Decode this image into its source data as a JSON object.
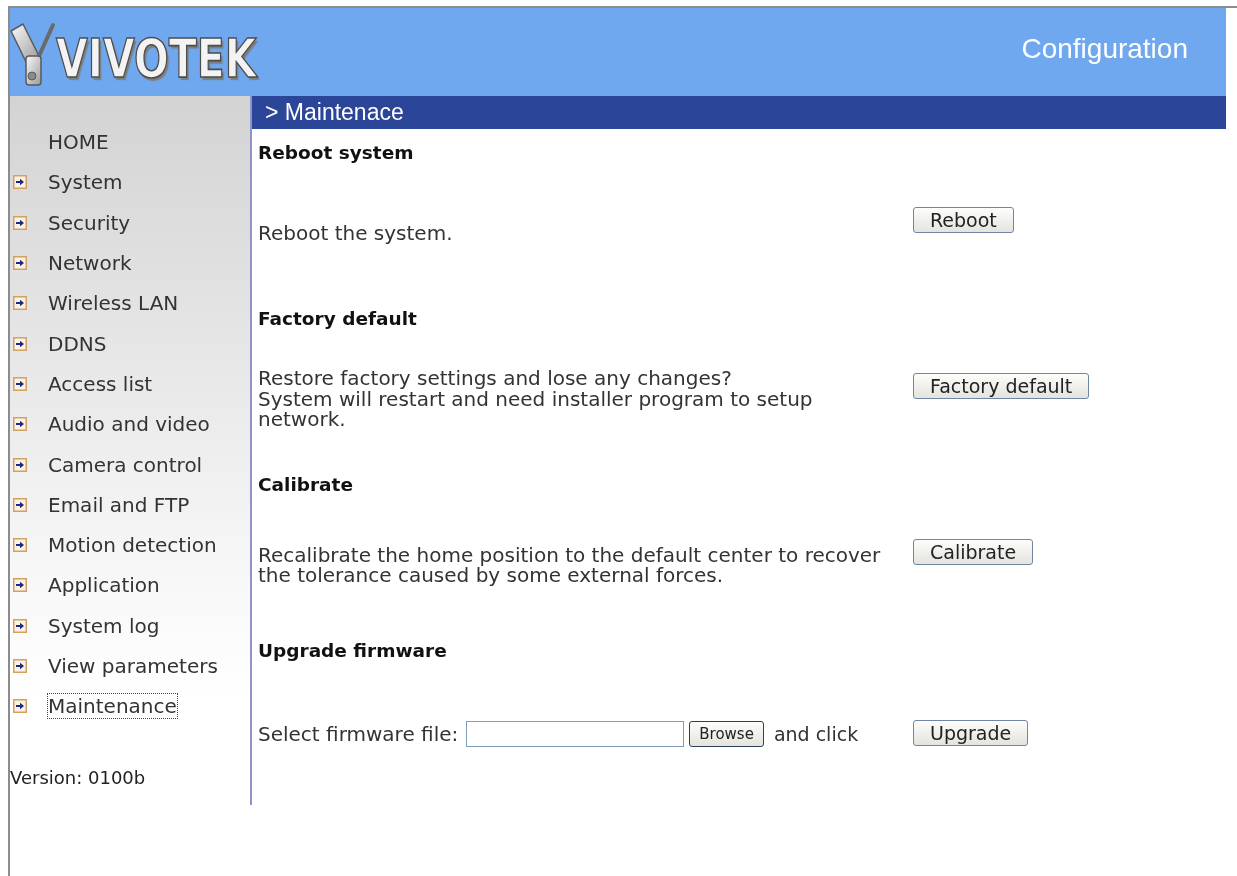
{
  "header": {
    "logo": "VIVOTEK",
    "title": "Configuration"
  },
  "sidebar": {
    "items": [
      {
        "label": "HOME",
        "kind": "home",
        "selected": false
      },
      {
        "label": "System",
        "kind": "link",
        "selected": false
      },
      {
        "label": "Security",
        "kind": "link",
        "selected": false
      },
      {
        "label": "Network",
        "kind": "link",
        "selected": false
      },
      {
        "label": "Wireless LAN",
        "kind": "link",
        "selected": false
      },
      {
        "label": "DDNS",
        "kind": "link",
        "selected": false
      },
      {
        "label": "Access list",
        "kind": "link",
        "selected": false
      },
      {
        "label": "Audio and video",
        "kind": "link",
        "selected": false
      },
      {
        "label": "Camera control",
        "kind": "link",
        "selected": false
      },
      {
        "label": "Email and FTP",
        "kind": "link",
        "selected": false
      },
      {
        "label": "Motion detection",
        "kind": "link",
        "selected": false
      },
      {
        "label": "Application",
        "kind": "link",
        "selected": false
      },
      {
        "label": "System log",
        "kind": "link",
        "selected": false
      },
      {
        "label": "View parameters",
        "kind": "link",
        "selected": false
      },
      {
        "label": "Maintenance",
        "kind": "link",
        "selected": true
      }
    ],
    "version": "Version: 0100b"
  },
  "page": {
    "title": "> Maintenace",
    "sections": [
      {
        "heading": "Reboot system",
        "kind": "action",
        "description": "Reboot the system.",
        "button": "Reboot"
      },
      {
        "heading": "Factory default",
        "kind": "action",
        "description": "Restore factory settings and lose any changes?\nSystem will restart and need installer program to setup network.",
        "button": "Factory default"
      },
      {
        "heading": "Calibrate",
        "kind": "action",
        "description": "Recalibrate the home position to the default center to recover the tolerance caused by some external forces.",
        "button": "Calibrate"
      },
      {
        "heading": "Upgrade firmware",
        "kind": "upload",
        "field_label": "Select firmware file:",
        "browse_button": "Browse",
        "suffix": "and click",
        "button": "Upgrade"
      }
    ]
  }
}
